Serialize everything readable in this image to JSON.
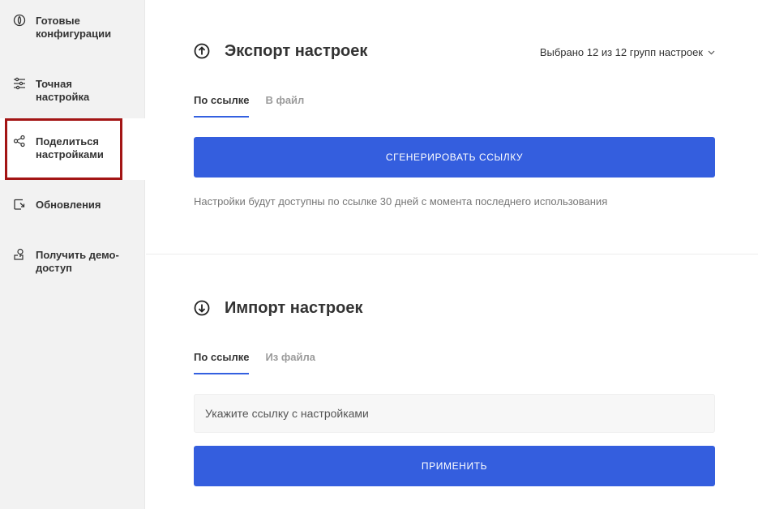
{
  "sidebar": {
    "items": [
      {
        "id": "ready-configs",
        "label_line1": "Готовые",
        "label_line2": "конфигурации",
        "icon": "preset-icon"
      },
      {
        "id": "fine-tuning",
        "label_line1": "Точная",
        "label_line2": "настройка",
        "icon": "sliders-icon"
      },
      {
        "id": "share-settings",
        "label_line1": "Поделиться",
        "label_line2": "настройками",
        "icon": "share-icon"
      },
      {
        "id": "updates",
        "label_line1": "Обновления",
        "label_line2": "",
        "icon": "update-icon"
      },
      {
        "id": "demo-access",
        "label_line1": "Получить демо-",
        "label_line2": "доступ",
        "icon": "key-icon"
      }
    ]
  },
  "export": {
    "title": "Экспорт настроек",
    "selector": "Выбрано 12 из 12 групп настроек",
    "tabs": [
      "По ссылке",
      "В файл"
    ],
    "button": "Сгенерировать ссылку",
    "hint": "Настройки будут доступны по ссылке 30 дней с момента последнего использования"
  },
  "import": {
    "title": "Импорт настроек",
    "tabs": [
      "По ссылке",
      "Из файла"
    ],
    "input_placeholder": "Укажите ссылку с настройками",
    "button": "Применить"
  },
  "colors": {
    "accent": "#345ede",
    "highlight": "#a31515",
    "sidebar_bg": "#f2f2f2"
  }
}
